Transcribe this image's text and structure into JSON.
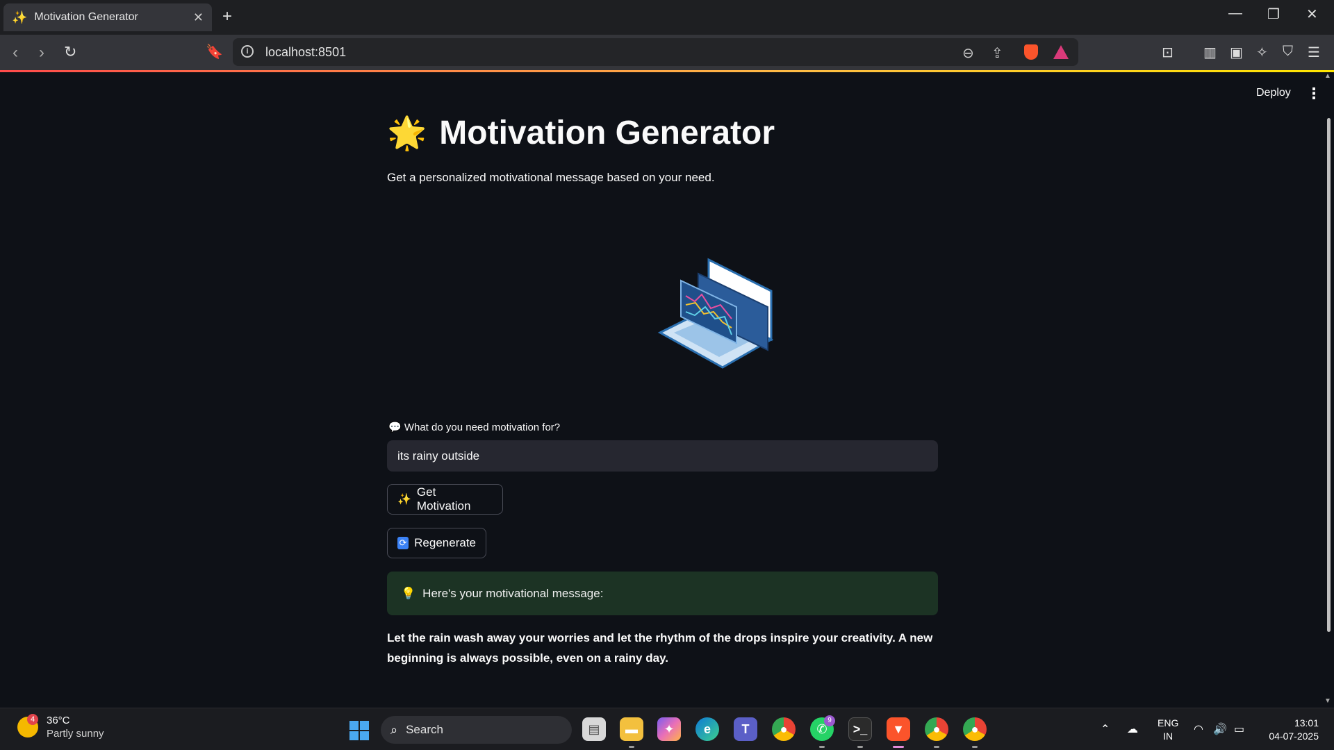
{
  "browser": {
    "tab_title": "Motivation Generator",
    "tab_favicon": "✨",
    "url": "localhost:8501",
    "accent": "#fb542b"
  },
  "app": {
    "deploy_label": "Deploy",
    "title_emoji": "🌟",
    "title": "Motivation Generator",
    "subtitle": "Get a personalized motivational message based on your need.",
    "input_label": "💬 What do you need motivation for?",
    "input_value": "its rainy outside",
    "get_button": "Get Motivation",
    "get_icon": "✨",
    "regen_button": "Regenerate",
    "regen_icon": "🔁",
    "success_icon": "💡",
    "success_text": "Here's your motivational message:",
    "message": "Let the rain wash away your worries and let the rhythm of the drops inspire your creativity. A new beginning is always possible, even on a rainy day.",
    "success_bg": "#1c3324"
  },
  "taskbar": {
    "weather_badge": "4",
    "temperature": "36°C",
    "condition": "Partly sunny",
    "search_label": "Search",
    "whatsapp_badge": "9",
    "lang_primary": "ENG",
    "lang_secondary": "IN",
    "time": "13:01",
    "date": "04-07-2025"
  }
}
